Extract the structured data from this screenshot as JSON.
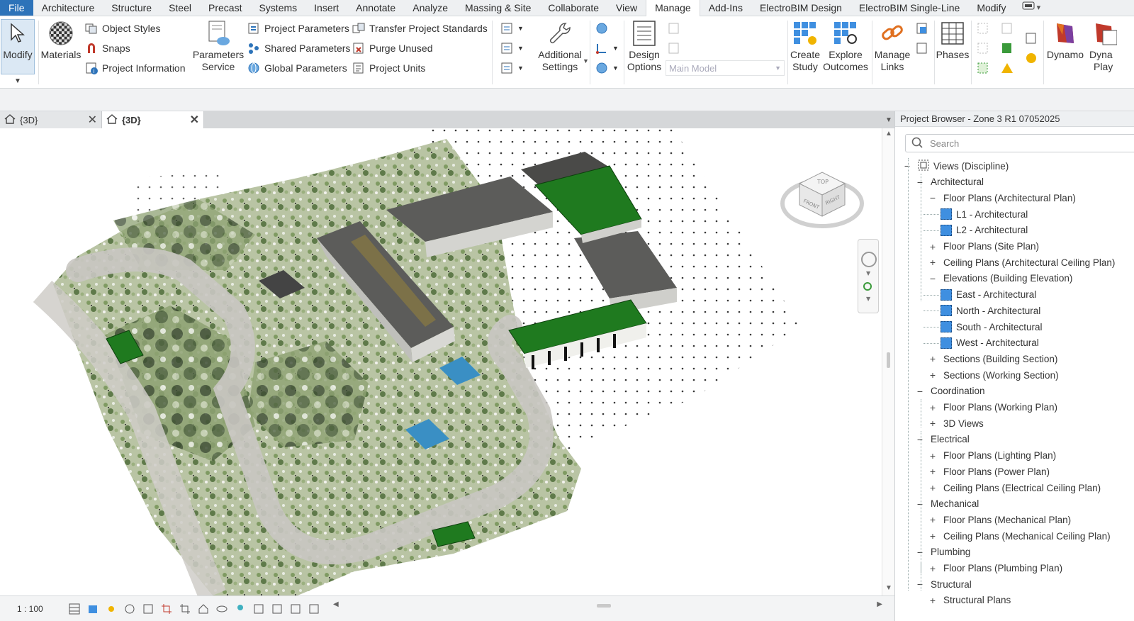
{
  "ribbon_tabs": [
    "File",
    "Architecture",
    "Structure",
    "Steel",
    "Precast",
    "Systems",
    "Insert",
    "Annotate",
    "Analyze",
    "Massing & Site",
    "Collaborate",
    "View",
    "Manage",
    "Add-Ins",
    "ElectroBIM Design",
    "ElectroBIM Single-Line",
    "Modify"
  ],
  "active_tab": "Manage",
  "ribbon": {
    "modify": "Modify",
    "materials": "Materials",
    "object_styles": "Object  Styles",
    "snaps": "Snaps",
    "project_information": "Project  Information",
    "parameters_service_1": "Parameters",
    "parameters_service_2": "Service",
    "project_parameters": "Project  Parameters",
    "shared_parameters": "Shared  Parameters",
    "global_parameters": "Global  Parameters",
    "transfer_project_standards": "Transfer  Project Standards",
    "purge_unused": "Purge  Unused",
    "project_units": "Project  Units",
    "additional_settings_1": "Additional",
    "additional_settings_2": "Settings",
    "design_options_1": "Design",
    "design_options_2": "Options",
    "main_model": "Main Model",
    "create_study_1": "Create",
    "create_study_2": "Study",
    "explore_outcomes_1": "Explore",
    "explore_outcomes_2": "Outcomes",
    "manage_links_1": "Manage",
    "manage_links_2": "Links",
    "phases": "Phases",
    "dynamo": "Dynamo",
    "dynamo_player_1": "Dyna",
    "dynamo_player_2": "Play"
  },
  "view_tabs": [
    {
      "label": "{3D}",
      "active": false
    },
    {
      "label": "{3D}",
      "active": true
    }
  ],
  "viewcube": {
    "top": "TOP",
    "front": "FRONT",
    "right": "RIGHT"
  },
  "status": {
    "scale": "1 : 100"
  },
  "project_browser": {
    "title": "Project Browser - Zone 3 R1 07052025",
    "search_placeholder": "Search",
    "tree": [
      {
        "label": "Views (Discipline)",
        "level": 0,
        "toggle": "−"
      },
      {
        "label": "Architectural",
        "level": 1,
        "toggle": "−"
      },
      {
        "label": "Floor Plans (Architectural Plan)",
        "level": 2,
        "toggle": "−"
      },
      {
        "label": "L1 - Architectural",
        "level": 3,
        "toggle": ""
      },
      {
        "label": "L2 - Architectural",
        "level": 3,
        "toggle": ""
      },
      {
        "label": "Floor Plans (Site Plan)",
        "level": 2,
        "toggle": "+"
      },
      {
        "label": "Ceiling Plans (Architectural Ceiling Plan)",
        "level": 2,
        "toggle": "+"
      },
      {
        "label": "Elevations (Building Elevation)",
        "level": 2,
        "toggle": "−"
      },
      {
        "label": "East - Architectural",
        "level": 3,
        "toggle": ""
      },
      {
        "label": "North - Architectural",
        "level": 3,
        "toggle": ""
      },
      {
        "label": "South - Architectural",
        "level": 3,
        "toggle": ""
      },
      {
        "label": "West - Architectural",
        "level": 3,
        "toggle": ""
      },
      {
        "label": "Sections (Building Section)",
        "level": 2,
        "toggle": "+"
      },
      {
        "label": "Sections (Working Section)",
        "level": 2,
        "toggle": "+"
      },
      {
        "label": "Coordination",
        "level": 1,
        "toggle": "−"
      },
      {
        "label": "Floor Plans (Working Plan)",
        "level": 2,
        "toggle": "+"
      },
      {
        "label": "3D Views",
        "level": 2,
        "toggle": "+"
      },
      {
        "label": "Electrical",
        "level": 1,
        "toggle": "−"
      },
      {
        "label": "Floor Plans (Lighting Plan)",
        "level": 2,
        "toggle": "+"
      },
      {
        "label": "Floor Plans (Power Plan)",
        "level": 2,
        "toggle": "+"
      },
      {
        "label": "Ceiling Plans (Electrical Ceiling Plan)",
        "level": 2,
        "toggle": "+"
      },
      {
        "label": "Mechanical",
        "level": 1,
        "toggle": "−"
      },
      {
        "label": "Floor Plans (Mechanical Plan)",
        "level": 2,
        "toggle": "+"
      },
      {
        "label": "Ceiling Plans (Mechanical Ceiling Plan)",
        "level": 2,
        "toggle": "+"
      },
      {
        "label": "Plumbing",
        "level": 1,
        "toggle": "−"
      },
      {
        "label": "Floor Plans (Plumbing Plan)",
        "level": 2,
        "toggle": "+"
      },
      {
        "label": "Structural",
        "level": 1,
        "toggle": "−"
      },
      {
        "label": "Structural Plans",
        "level": 2,
        "toggle": "+"
      }
    ]
  },
  "colors": {
    "file_tab": "#2d73b9",
    "roof_green": "#1f7a1f",
    "roof_grey": "#5a5a58",
    "view_icon": "#3f8fe0"
  }
}
